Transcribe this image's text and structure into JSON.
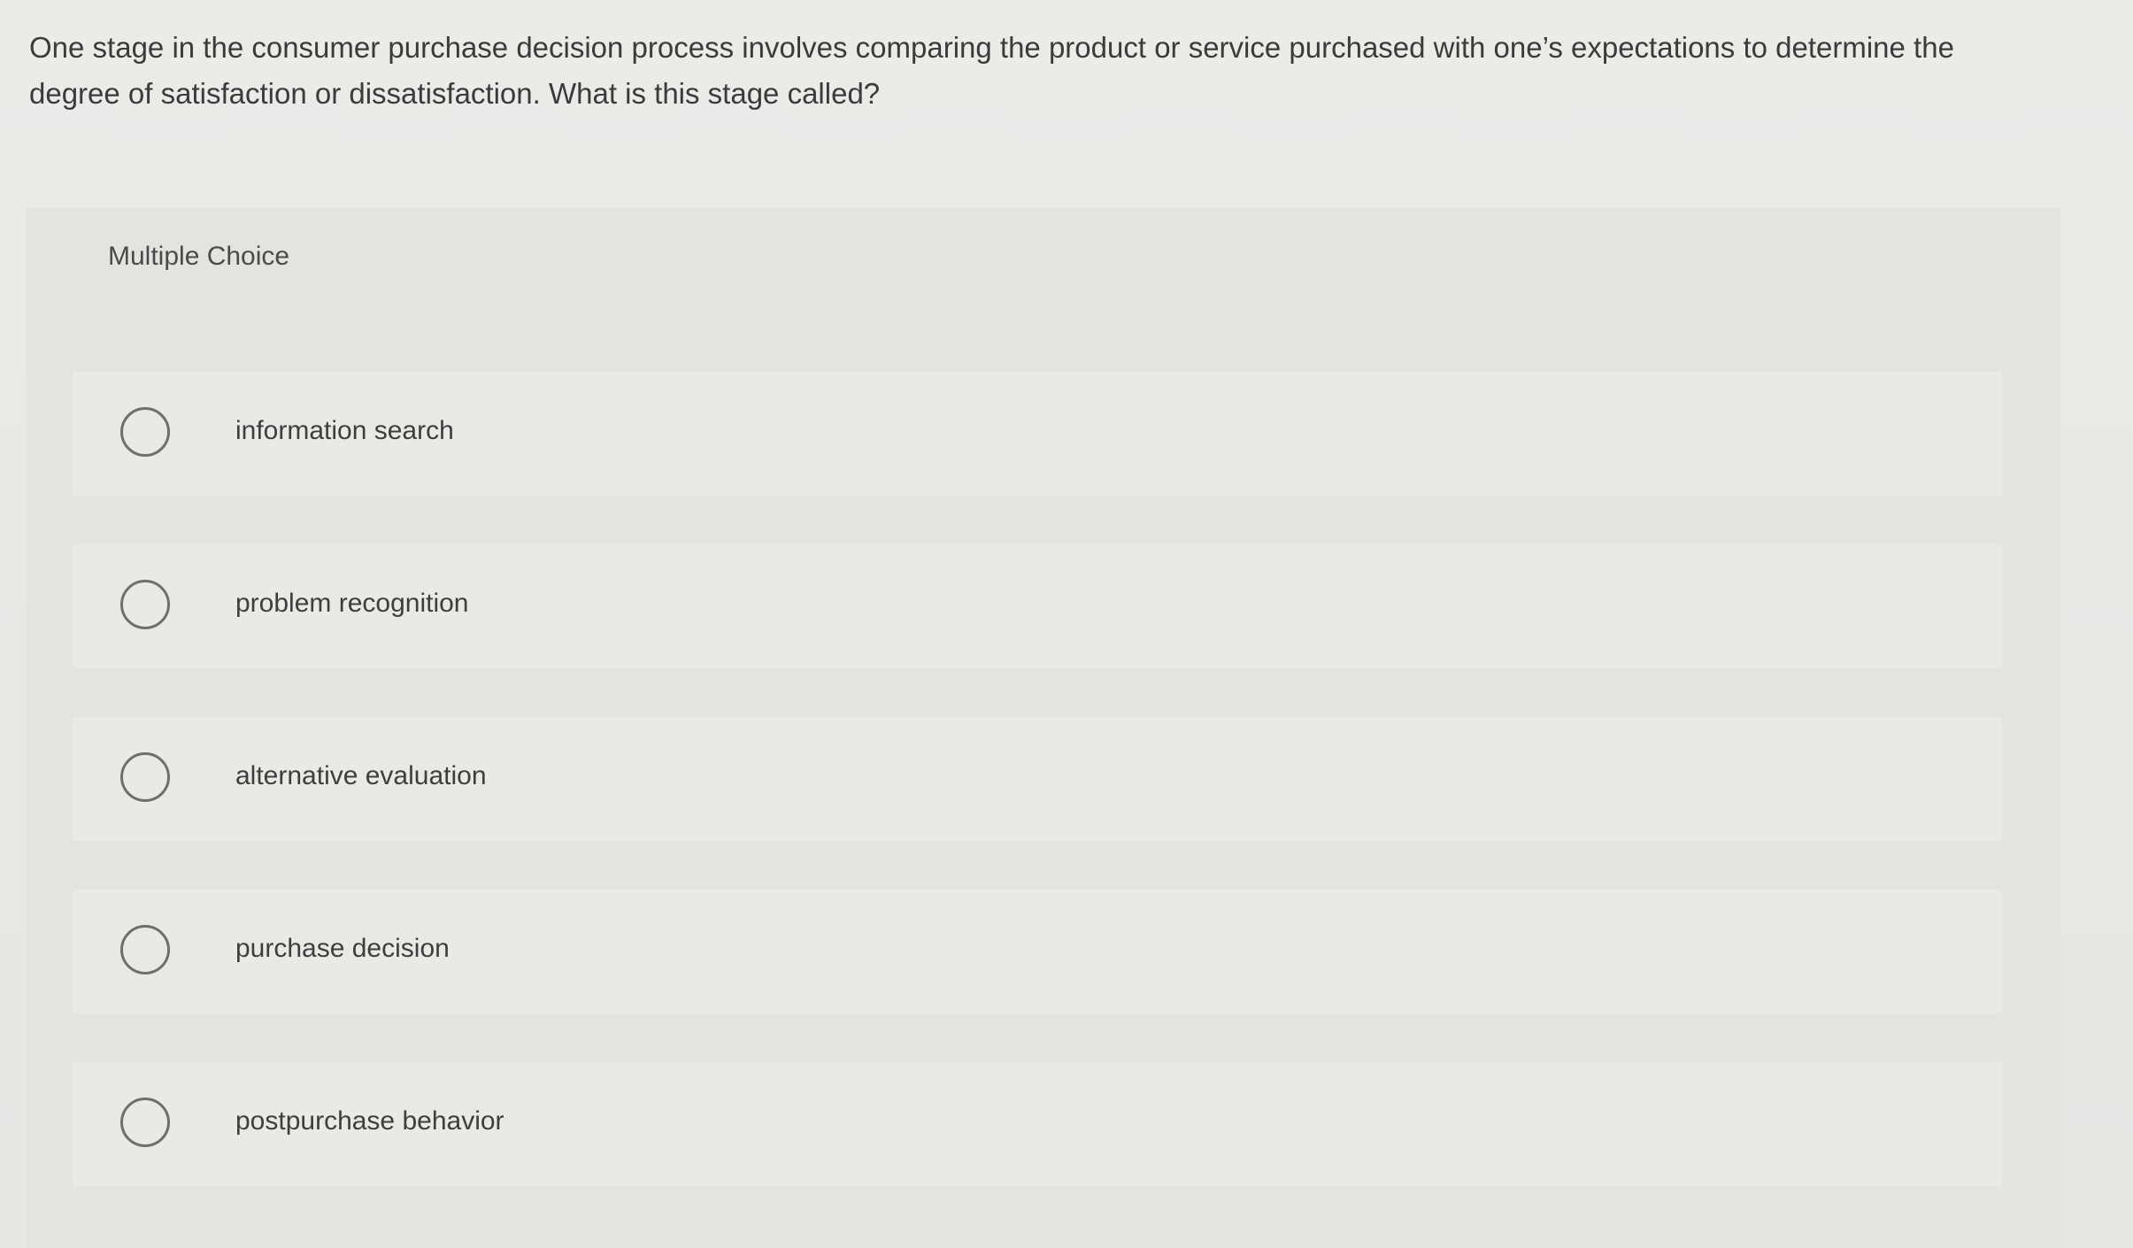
{
  "question": {
    "text": "One stage in the consumer purchase decision process involves comparing the product or service purchased with one’s expectations to determine the degree of satisfaction or dissatisfaction. What is this stage called?"
  },
  "multiple_choice": {
    "label": "Multiple Choice",
    "options": [
      {
        "label": "information search",
        "selected": false
      },
      {
        "label": "problem recognition",
        "selected": false
      },
      {
        "label": "alternative evaluation",
        "selected": false
      },
      {
        "label": "purchase decision",
        "selected": false
      },
      {
        "label": "postpurchase behavior",
        "selected": false
      }
    ]
  }
}
